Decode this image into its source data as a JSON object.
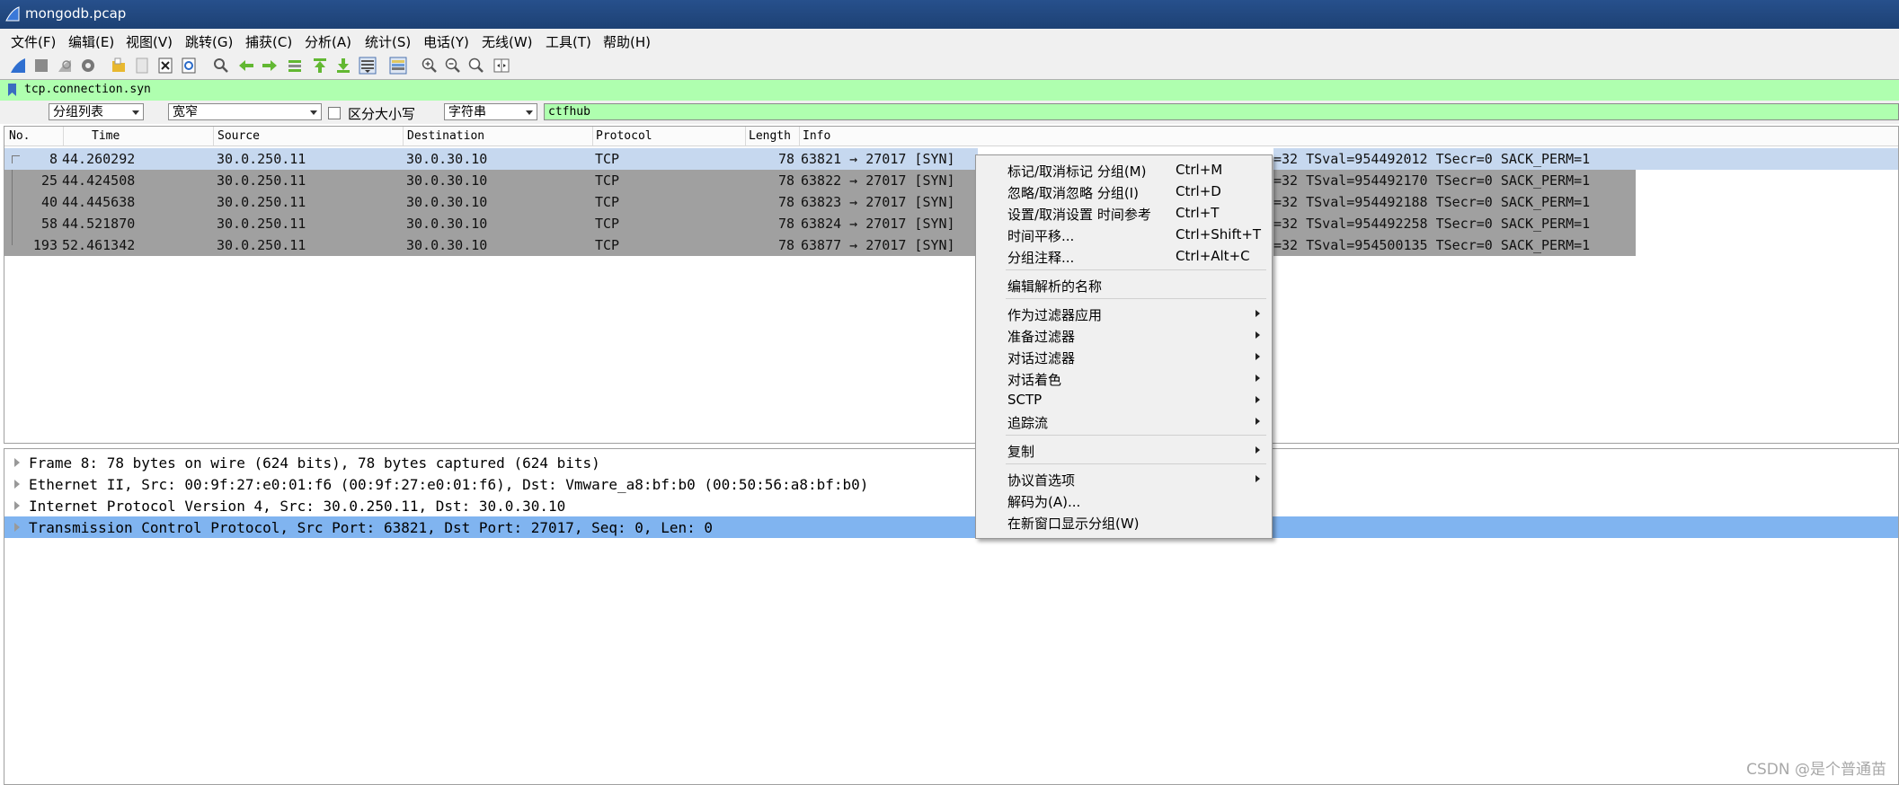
{
  "window": {
    "title": "mongodb.pcap"
  },
  "menubar": [
    "文件(F)",
    "编辑(E)",
    "视图(V)",
    "跳转(G)",
    "捕获(C)",
    "分析(A)",
    "统计(S)",
    "电话(Y)",
    "无线(W)",
    "工具(T)",
    "帮助(H)"
  ],
  "toolbar": [
    "shark-fin-start-icon",
    "stop-icon",
    "restart-icon",
    "capture-options-icon",
    "open-icon",
    "save-icon",
    "close-file-icon",
    "reload-icon",
    "find-icon",
    "go-back-icon",
    "go-forward-icon",
    "go-to-packet-icon",
    "first-packet-icon",
    "last-packet-icon",
    "autoscroll-icon",
    "colorize-icon",
    "zoom-in-icon",
    "zoom-out-icon",
    "normal-size-icon",
    "resize-columns-icon"
  ],
  "filter": {
    "value": "tcp.connection.syn"
  },
  "search": {
    "scope": "分组列表",
    "width": "宽窄",
    "case_label": "区分大小写",
    "type": "字符串",
    "value": "ctfhub"
  },
  "columns": [
    "No.",
    "Time",
    "Source",
    "Destination",
    "Protocol",
    "Length",
    "Info"
  ],
  "packets": [
    {
      "no": "8",
      "time": "44.260292",
      "src": "30.0.250.11",
      "dst": "30.0.30.10",
      "proto": "TCP",
      "len": "78",
      "info": "63821 → 27017 [SYN]",
      "tail": "=32 TSval=954492012 TSecr=0 SACK_PERM=1",
      "selected": true
    },
    {
      "no": "25",
      "time": "44.424508",
      "src": "30.0.250.11",
      "dst": "30.0.30.10",
      "proto": "TCP",
      "len": "78",
      "info": "63822 → 27017 [SYN]",
      "tail": "=32 TSval=954492170 TSecr=0 SACK_PERM=1",
      "selected": false
    },
    {
      "no": "40",
      "time": "44.445638",
      "src": "30.0.250.11",
      "dst": "30.0.30.10",
      "proto": "TCP",
      "len": "78",
      "info": "63823 → 27017 [SYN]",
      "tail": "=32 TSval=954492188 TSecr=0 SACK_PERM=1",
      "selected": false
    },
    {
      "no": "58",
      "time": "44.521870",
      "src": "30.0.250.11",
      "dst": "30.0.30.10",
      "proto": "TCP",
      "len": "78",
      "info": "63824 → 27017 [SYN]",
      "tail": "=32 TSval=954492258 TSecr=0 SACK_PERM=1",
      "selected": false
    },
    {
      "no": "193",
      "time": "52.461342",
      "src": "30.0.250.11",
      "dst": "30.0.30.10",
      "proto": "TCP",
      "len": "78",
      "info": "63877 → 27017 [SYN]",
      "tail": "=32 TSval=954500135 TSecr=0 SACK_PERM=1",
      "selected": false
    }
  ],
  "details": [
    "Frame 8: 78 bytes on wire (624 bits), 78 bytes captured (624 bits)",
    "Ethernet II, Src: 00:9f:27:e0:01:f6 (00:9f:27:e0:01:f6), Dst: Vmware_a8:bf:b0 (00:50:56:a8:bf:b0)",
    "Internet Protocol Version 4, Src: 30.0.250.11, Dst: 30.0.30.10",
    "Transmission Control Protocol, Src Port: 63821, Dst Port: 27017, Seq: 0, Len: 0"
  ],
  "context_menu": [
    {
      "label": "标记/取消标记 分组(M)",
      "shortcut": "Ctrl+M"
    },
    {
      "label": "忽略/取消忽略 分组(I)",
      "shortcut": "Ctrl+D"
    },
    {
      "label": "设置/取消设置 时间参考",
      "shortcut": "Ctrl+T"
    },
    {
      "label": "时间平移...",
      "shortcut": "Ctrl+Shift+T"
    },
    {
      "label": "分组注释...",
      "shortcut": "Ctrl+Alt+C"
    },
    {
      "label": "编辑解析的名称",
      "shortcut": ""
    },
    {
      "label": "作为过滤器应用",
      "shortcut": "",
      "submenu": true
    },
    {
      "label": "准备过滤器",
      "shortcut": "",
      "submenu": true
    },
    {
      "label": "对话过滤器",
      "shortcut": "",
      "submenu": true
    },
    {
      "label": "对话着色",
      "shortcut": "",
      "submenu": true
    },
    {
      "label": "SCTP",
      "shortcut": "",
      "submenu": true
    },
    {
      "label": "追踪流",
      "shortcut": "",
      "submenu": true
    },
    {
      "label": "复制",
      "shortcut": "",
      "submenu": true
    },
    {
      "label": "协议首选项",
      "shortcut": "",
      "submenu": true
    },
    {
      "label": "解码为(A)...",
      "shortcut": ""
    },
    {
      "label": "在新窗口显示分组(W)",
      "shortcut": ""
    }
  ],
  "watermark": "CSDN @是个普通苗"
}
